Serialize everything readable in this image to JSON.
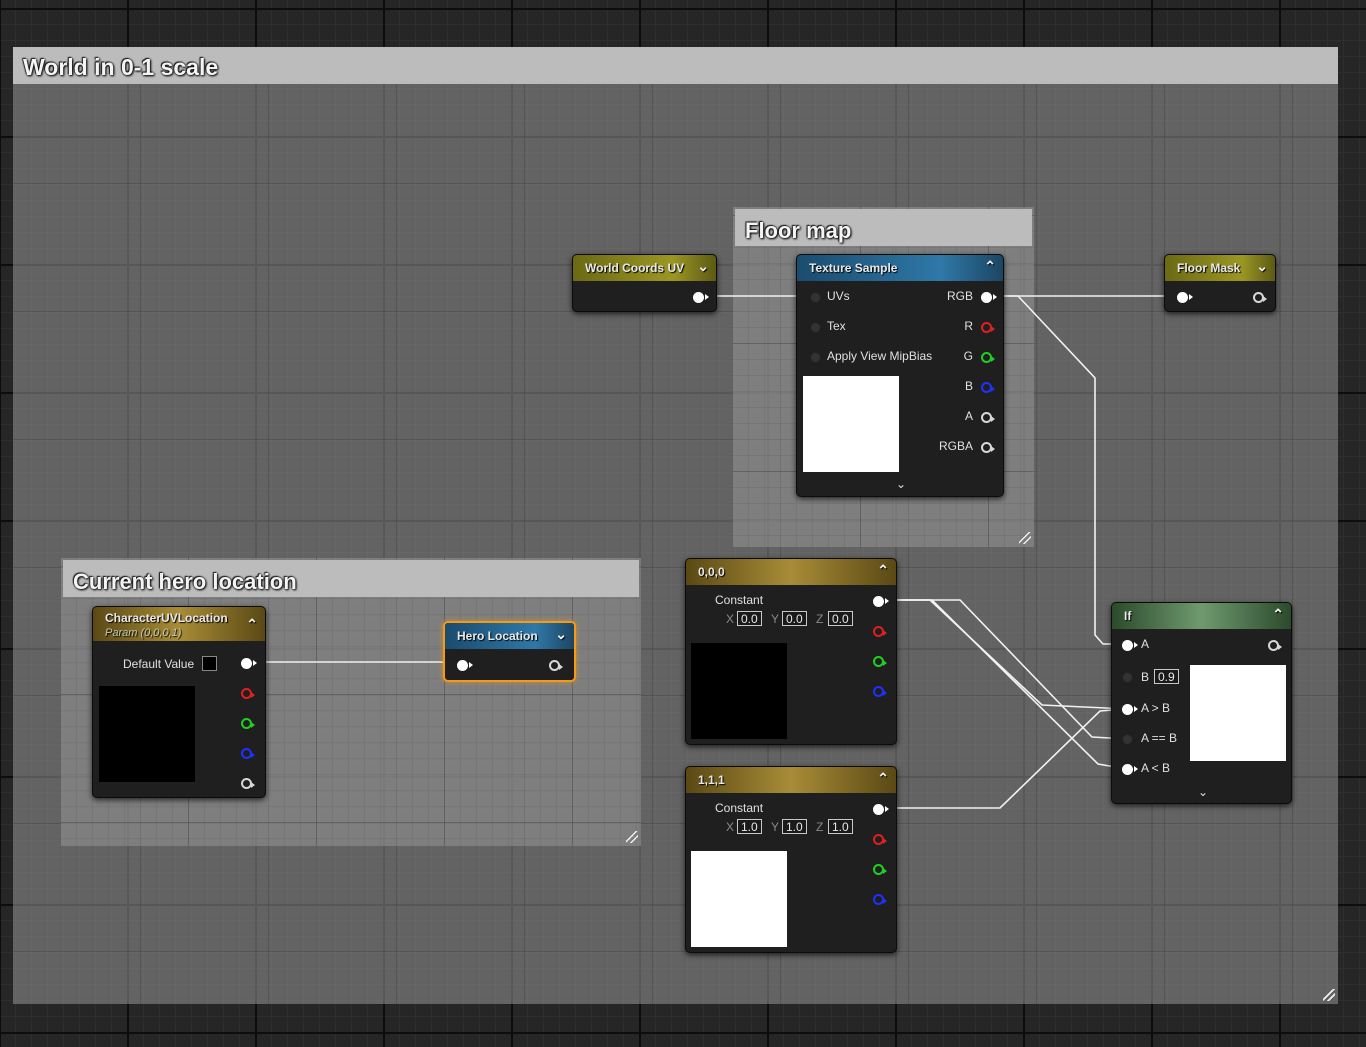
{
  "comments": {
    "world": "World in 0-1 scale",
    "floor": "Floor map",
    "hero": "Current hero location"
  },
  "nodes": {
    "world_coords": {
      "title": "World Coords UV"
    },
    "texture_sample": {
      "title": "Texture Sample",
      "inputs": [
        "UVs",
        "Tex",
        "Apply View MipBias"
      ],
      "outputs": [
        "RGB",
        "R",
        "G",
        "B",
        "A",
        "RGBA"
      ]
    },
    "floor_mask": {
      "title": "Floor Mask"
    },
    "char_uv": {
      "title": "CharacterUVLocation",
      "subtitle": "Param (0,0,0,1)",
      "default_label": "Default Value"
    },
    "hero_location": {
      "title": "Hero Location"
    },
    "const_000": {
      "title": "0,0,0",
      "label": "Constant",
      "x": "0.0",
      "y": "0.0",
      "z": "0.0"
    },
    "const_111": {
      "title": "1,1,1",
      "label": "Constant",
      "x": "1.0",
      "y": "1.0",
      "z": "1.0"
    },
    "if_node": {
      "title": "If",
      "inputs": [
        "A",
        "B",
        "A > B",
        "A == B",
        "A < B"
      ],
      "b_value": "0.9"
    }
  },
  "axis_labels": {
    "x": "X",
    "y": "Y",
    "z": "Z"
  },
  "colors": {
    "selection": "#f59a17",
    "pin_red": "#e02020",
    "pin_green": "#20d020",
    "pin_blue": "#2030ff"
  },
  "icons": {
    "collapse": "chevron-up-icon",
    "expand": "chevron-down-icon",
    "resize": "resize-grip-icon"
  }
}
